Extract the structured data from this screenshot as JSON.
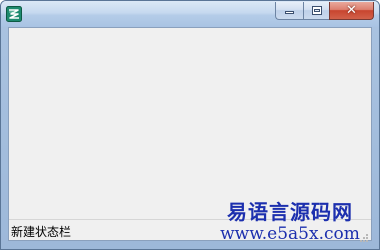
{
  "window": {
    "title": "",
    "icon": "app-logo-icon"
  },
  "caption_buttons": {
    "minimize": "minimize-icon",
    "maximize": "maximize-icon",
    "close": "close-icon",
    "close_glyph": "✕"
  },
  "status_bar": {
    "text": "新建状态栏"
  },
  "watermark": {
    "name": "易语言源码网",
    "url": "www.e5a5x.com"
  },
  "colors": {
    "watermark": "#1c2fae",
    "client_bg": "#f0f0f0",
    "close_button": "#c8452f"
  }
}
